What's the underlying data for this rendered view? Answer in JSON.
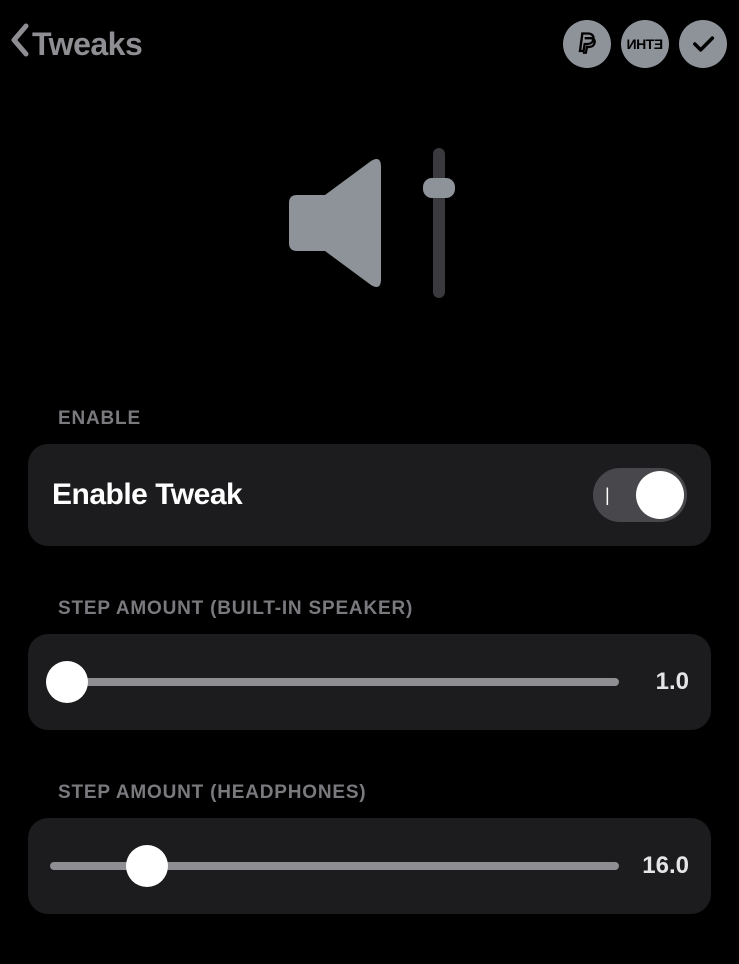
{
  "header": {
    "back_label": "Tweaks",
    "icons": {
      "paypal": "paypal-icon",
      "eth": "ETHN",
      "check": "check-icon"
    }
  },
  "sections": {
    "enable": {
      "header": "ENABLE",
      "toggle_label": "Enable Tweak",
      "toggle_state": true
    },
    "speaker": {
      "header": "STEP AMOUNT (BUILT-IN SPEAKER)",
      "value": "1.0",
      "thumb_percent": 3
    },
    "headphones": {
      "header": "STEP AMOUNT (HEADPHONES)",
      "value": "16.0",
      "thumb_percent": 17
    }
  }
}
